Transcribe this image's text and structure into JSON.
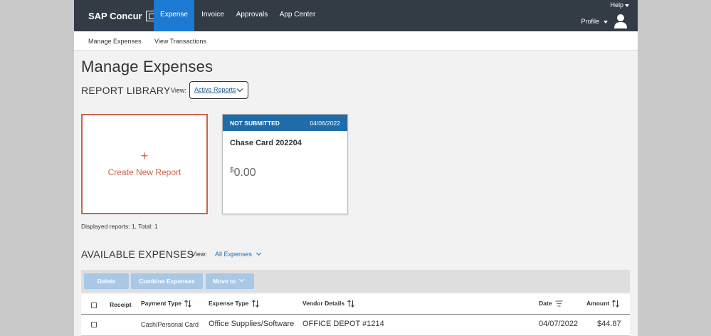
{
  "topbar": {
    "brand": "SAP Concur",
    "nav": [
      "Expense",
      "Invoice",
      "Approvals",
      "App Center"
    ],
    "help": "Help",
    "profile": "Profile"
  },
  "subnav": [
    "Manage Expenses",
    "View Transactions"
  ],
  "page_title": "Manage Expenses",
  "report_library": {
    "title": "REPORT LIBRARY",
    "view_label": "View:",
    "view_value": "Active Reports",
    "create_label": "Create New Report",
    "create_plus": "+",
    "report": {
      "status": "NOT SUBMITTED",
      "date": "04/06/2022",
      "name": "Chase Card 202204",
      "currency": "$",
      "amount": "0.00"
    },
    "displayed": "Displayed reports: 1, Total: 1"
  },
  "available_expenses": {
    "title": "AVAILABLE EXPENSES",
    "view_label": "View:",
    "view_value": "All Expenses",
    "toolbar": {
      "delete": "Delete",
      "combine": "Combine Expenses",
      "move": "Move to"
    },
    "columns": [
      "Receipt",
      "Payment Type",
      "Expense Type",
      "Vendor Details",
      "Date",
      "Amount"
    ],
    "rows": [
      {
        "payment_type": "Cash/Personal Card",
        "expense_type": "Office Supplies/Software",
        "vendor": "OFFICE DEPOT #1214",
        "date": "04/07/2022",
        "amount": "$44.87"
      }
    ]
  },
  "colors": {
    "nav_bg": "#333b45",
    "active": "#1c7ad3",
    "accent": "#c9654a",
    "card_head": "#1f6ca8",
    "button_disabled": "#a9c8e6"
  }
}
